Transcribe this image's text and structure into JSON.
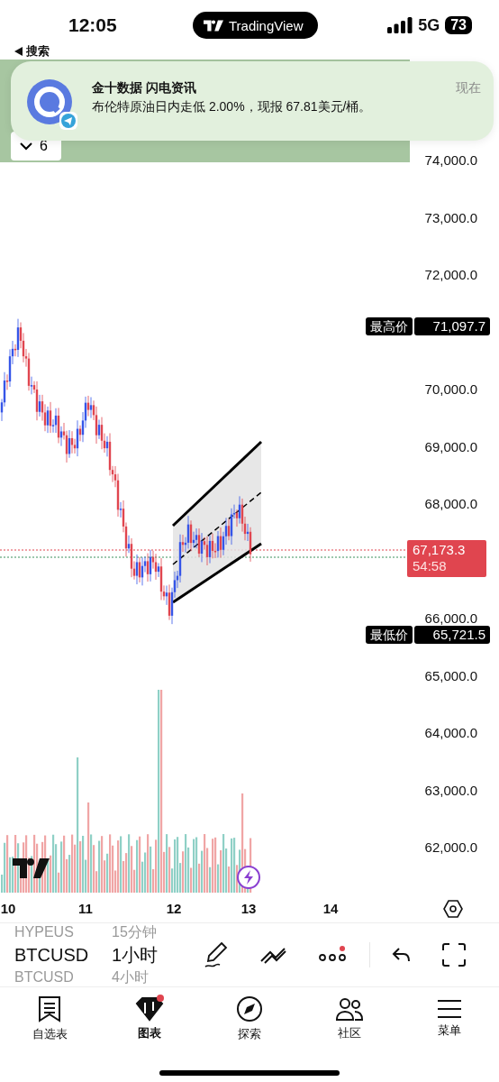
{
  "status_bar": {
    "time": "12:05",
    "island_app": "TradingView",
    "network": "5G",
    "battery": "73"
  },
  "back_link": {
    "label": "搜索"
  },
  "notification": {
    "app": "金十数据 闪电资讯",
    "message": "布伦特原油日内走低 2.00%，现报 67.81美元/桶。",
    "time": "现在"
  },
  "chart": {
    "panel_button": "6",
    "price_axis": [
      "74,000.0",
      "73,000.0",
      "72,000.0",
      "70,000.0",
      "69,000.0",
      "68,000.0",
      "66,000.0",
      "65,000.0",
      "64,000.0",
      "63,000.0",
      "62,000.0"
    ],
    "markers": [
      {
        "kind": "high",
        "label": "最高价",
        "value": "71,097.7"
      },
      {
        "kind": "last",
        "value": "67,173.3",
        "countdown": "54:58"
      },
      {
        "kind": "low",
        "label": "最低价",
        "value": "65,721.5"
      }
    ],
    "time_axis": [
      "10",
      "11",
      "12",
      "13",
      "14"
    ]
  },
  "toolbar": {
    "symbols": [
      {
        "symbol": "HYPEUS",
        "interval": "15分钟",
        "selected": false
      },
      {
        "symbol": "BTCUSD",
        "interval": "1小时",
        "selected": true
      },
      {
        "symbol": "BTCUSD",
        "interval": "4小时",
        "selected": false
      }
    ],
    "more_badge": true
  },
  "tabs": [
    {
      "label": "自选表",
      "selected": false,
      "badge": false
    },
    {
      "label": "图表",
      "selected": true,
      "badge": true
    },
    {
      "label": "探索",
      "selected": false,
      "badge": false
    },
    {
      "label": "社区",
      "selected": false,
      "badge": false
    },
    {
      "label": "菜单",
      "selected": false,
      "badge": false
    }
  ]
}
